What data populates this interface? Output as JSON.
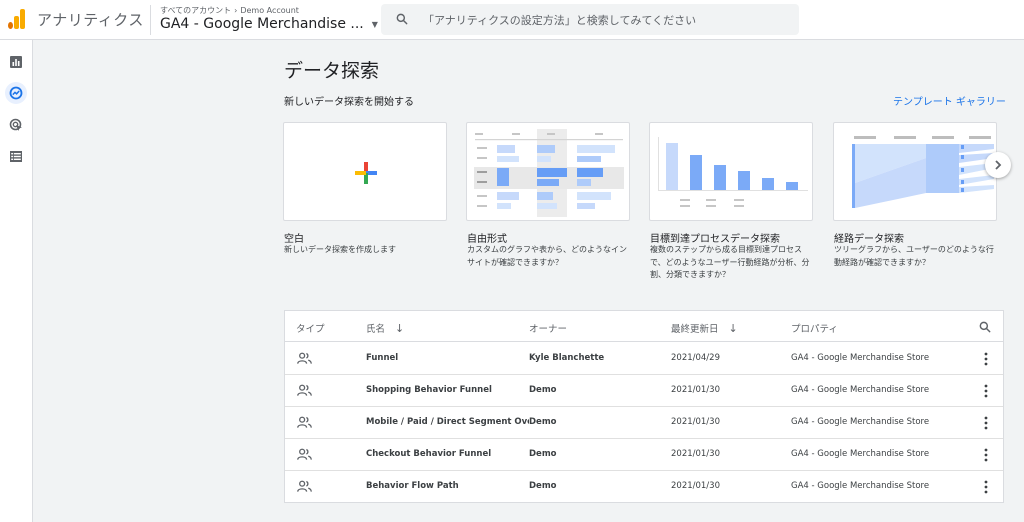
{
  "topbar": {
    "app_name": "アナリティクス",
    "breadcrumb": [
      "すべてのアカウント",
      "Demo Account"
    ],
    "account_name": "GA4 - Google Merchandise ...",
    "search_placeholder": "「アナリティクスの設定方法」と検索してみてください"
  },
  "nav": {
    "items": [
      {
        "icon": "bar-chart-icon",
        "active": false
      },
      {
        "icon": "explore-icon",
        "active": true
      },
      {
        "icon": "advertising-icon",
        "active": false
      },
      {
        "icon": "list-icon",
        "active": false
      }
    ]
  },
  "main": {
    "title": "データ探索",
    "subtitle": "新しいデータ探索を開始する",
    "gallery_link": "テンプレート ギャラリー"
  },
  "templates": [
    {
      "title": "空白",
      "desc": "新しいデータ探索を作成します",
      "icon": "plus-icon"
    },
    {
      "title": "自由形式",
      "desc": "カスタムのグラフや表から、どのようなインサイトが確認できますか？",
      "icon": "freeform-icon"
    },
    {
      "title": "目標到達プロセスデータ探索",
      "desc": "複数のステップから成る目標到達プロセスで、どのようなユーザー行動経路が分析、分割、分類できますか？",
      "icon": "funnel-icon"
    },
    {
      "title": "経路データ探索",
      "desc": "ツリーグラフから、ユーザーのどのような行動経路が確認できますか？",
      "icon": "path-icon"
    }
  ],
  "table": {
    "headers": {
      "type": "タイプ",
      "name": "氏名",
      "owner": "オーナー",
      "modified": "最終更新日",
      "property": "プロパティ"
    },
    "rows": [
      {
        "name": "Funnel",
        "owner": "Kyle Blanchette",
        "date": "2021/04/29",
        "property": "GA4 - Google Merchandise Store"
      },
      {
        "name": "Shopping Behavior Funnel",
        "owner": "Demo",
        "date": "2021/01/30",
        "property": "GA4 - Google Merchandise Store"
      },
      {
        "name": "Mobile / Paid / Direct Segment Overlap",
        "owner": "Demo",
        "date": "2021/01/30",
        "property": "GA4 - Google Merchandise Store"
      },
      {
        "name": "Checkout Behavior Funnel",
        "owner": "Demo",
        "date": "2021/01/30",
        "property": "GA4 - Google Merchandise Store"
      },
      {
        "name": "Behavior Flow Path",
        "owner": "Demo",
        "date": "2021/01/30",
        "property": "GA4 - Google Merchandise Store"
      }
    ]
  },
  "colors": {
    "accent": "#1a73e8",
    "logo_orange": "#f9ab00",
    "logo_dark": "#e37400"
  }
}
